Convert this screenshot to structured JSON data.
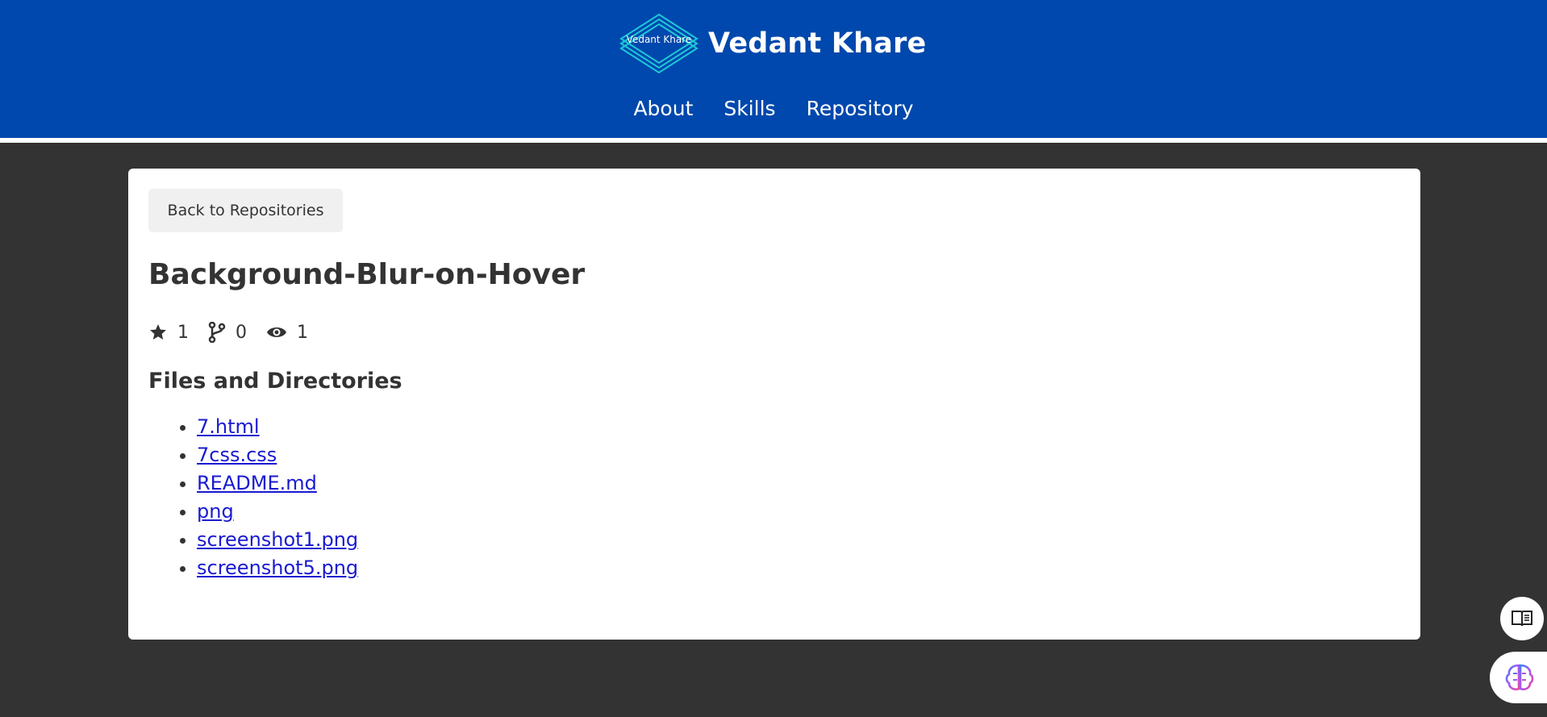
{
  "header": {
    "logo_text": "Vedant Khare",
    "brand_name": "Vedant Khare",
    "nav": [
      {
        "label": "About"
      },
      {
        "label": "Skills"
      },
      {
        "label": "Repository"
      }
    ],
    "background_color": "#0048ad"
  },
  "main": {
    "back_button_label": "Back to Repositories",
    "repo_title": "Background-Blur-on-Hover",
    "stats": {
      "stars": "1",
      "forks": "0",
      "watchers": "1"
    },
    "files_heading": "Files and Directories",
    "files": [
      {
        "name": "7.html"
      },
      {
        "name": "7css.css"
      },
      {
        "name": "README.md"
      },
      {
        "name": "png"
      },
      {
        "name": "screenshot1.png"
      },
      {
        "name": "screenshot5.png"
      }
    ]
  },
  "floating": {
    "reader_icon": "book-reader-icon",
    "ai_icon": "brain-icon"
  },
  "colors": {
    "page_background": "#333333",
    "link": "#1a1ad1",
    "accent_logo": "#1ec8d8"
  }
}
